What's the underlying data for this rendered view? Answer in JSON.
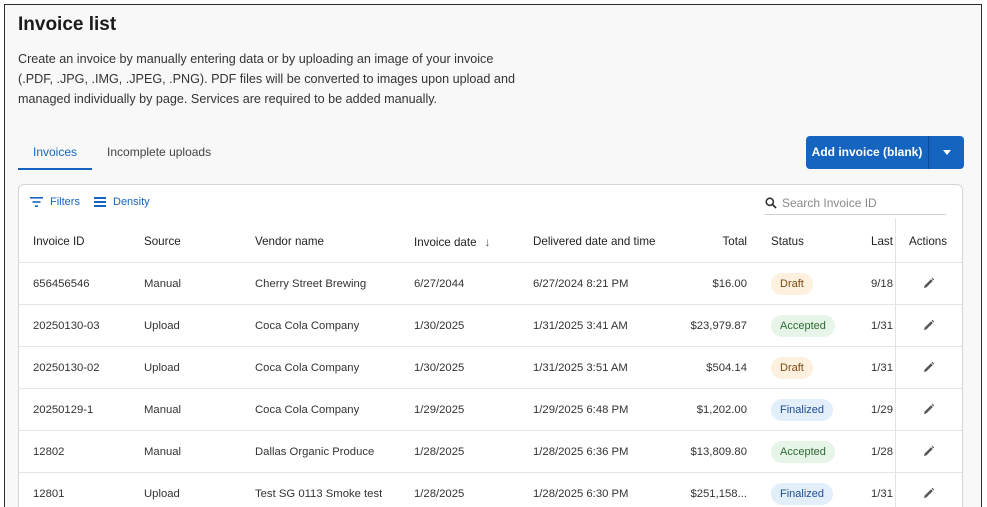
{
  "page": {
    "title": "Invoice list",
    "description": "Create an invoice by manually entering data or by uploading an image of your invoice (.PDF, .JPG, .IMG, .JPEG, .PNG). PDF files will be converted to images upon upload and managed individually by page. Services are required to be added manually."
  },
  "tabs": [
    {
      "label": "Invoices",
      "active": true
    },
    {
      "label": "Incomplete uploads",
      "active": false
    }
  ],
  "actions": {
    "add_label": "Add invoice (blank)"
  },
  "toolbar": {
    "filters_label": "Filters",
    "density_label": "Density",
    "search_placeholder": "Search Invoice ID"
  },
  "table": {
    "columns": {
      "invoice_id": "Invoice ID",
      "source": "Source",
      "vendor": "Vendor name",
      "invoice_date": "Invoice date",
      "delivered": "Delivered date and time",
      "total": "Total",
      "status": "Status",
      "last": "Last",
      "actions": "Actions"
    },
    "rows": [
      {
        "id": "656456546",
        "source": "Manual",
        "vendor": "Cherry Street Brewing",
        "invoice_date": "6/27/2044",
        "delivered": "6/27/2024 8:21 PM",
        "total": "$16.00",
        "status": "Draft",
        "last": "9/18,"
      },
      {
        "id": "20250130-03",
        "source": "Upload",
        "vendor": "Coca Cola Company",
        "invoice_date": "1/30/2025",
        "delivered": "1/31/2025 3:41 AM",
        "total": "$23,979.87",
        "status": "Accepted",
        "last": "1/31,"
      },
      {
        "id": "20250130-02",
        "source": "Upload",
        "vendor": "Coca Cola Company",
        "invoice_date": "1/30/2025",
        "delivered": "1/31/2025 3:51 AM",
        "total": "$504.14",
        "status": "Draft",
        "last": "1/31,"
      },
      {
        "id": "20250129-1",
        "source": "Manual",
        "vendor": "Coca Cola Company",
        "invoice_date": "1/29/2025",
        "delivered": "1/29/2025 6:48 PM",
        "total": "$1,202.00",
        "status": "Finalized",
        "last": "1/29,"
      },
      {
        "id": "12802",
        "source": "Manual",
        "vendor": "Dallas Organic Produce",
        "invoice_date": "1/28/2025",
        "delivered": "1/28/2025 6:36 PM",
        "total": "$13,809.80",
        "status": "Accepted",
        "last": "1/28,"
      },
      {
        "id": "12801",
        "source": "Upload",
        "vendor": "Test SG 0113 Smoke test",
        "invoice_date": "1/28/2025",
        "delivered": "1/28/2025 6:30 PM",
        "total": "$251,158...",
        "status": "Finalized",
        "last": "1/31,"
      }
    ]
  },
  "colors": {
    "accent": "#1565c0",
    "draft": "#fdf0de",
    "accepted": "#e7f4e8",
    "finalized": "#e3eefb"
  }
}
